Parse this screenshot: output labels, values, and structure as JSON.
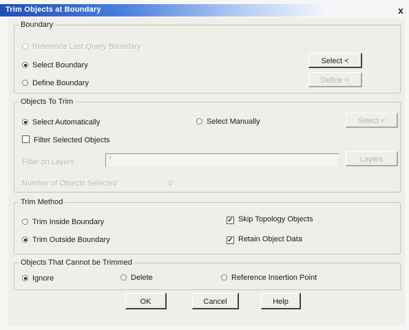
{
  "window": {
    "title": "Trim Objects at Boundary",
    "close_label": "x"
  },
  "boundary": {
    "legend": "Boundary",
    "options": [
      {
        "label": "Reference Last Query Boundary",
        "checked": false,
        "enabled": false
      },
      {
        "label": "Select Boundary",
        "checked": true,
        "enabled": true
      },
      {
        "label": "Define Boundary",
        "checked": false,
        "enabled": true
      }
    ],
    "select_button": "Select <",
    "define_button": "Define <"
  },
  "objects_to_trim": {
    "legend": "Objects To Trim",
    "select_automatically": "Select Automatically",
    "select_manually": "Select Manually",
    "select_button": "Select <",
    "filter_selected": "Filter Selected Objects",
    "filter_on_layers_label": "Filter on Layers",
    "filter_on_layers_value": "*",
    "layers_button": "Layers",
    "number_selected_label": "Number of Objects Selected",
    "number_selected_value": "0"
  },
  "trim_method": {
    "legend": "Trim Method",
    "trim_inside": "Trim Inside Boundary",
    "trim_outside": "Trim Outside Boundary",
    "skip_topology": "Skip Topology Objects",
    "retain_data": "Retain Object Data"
  },
  "cannot_trim": {
    "legend": "Objects That Cannot be Trimmed",
    "ignore": "Ignore",
    "delete": "Delete",
    "reference_point": "Reference Insertion Point"
  },
  "buttons": {
    "ok": "OK",
    "cancel": "Cancel",
    "help": "Help"
  }
}
